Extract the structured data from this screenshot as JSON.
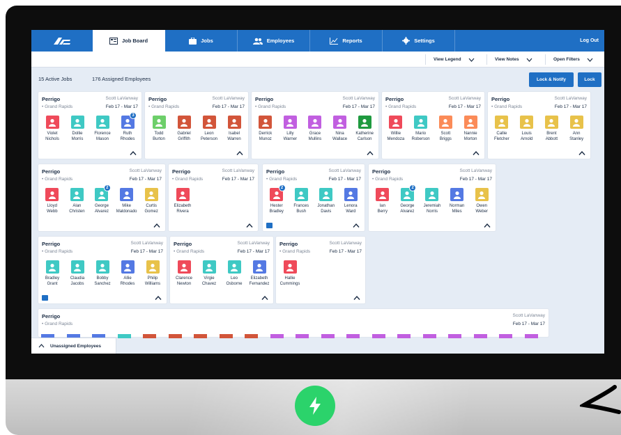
{
  "nav": {
    "tabs": [
      {
        "label": "Job Board",
        "icon": "board-icon",
        "active": true
      },
      {
        "label": "Jobs",
        "icon": "briefcase-icon"
      },
      {
        "label": "Employees",
        "icon": "people-icon"
      },
      {
        "label": "Reports",
        "icon": "chart-icon"
      },
      {
        "label": "Settings",
        "icon": "gear-icon"
      }
    ],
    "logout": "Log Out"
  },
  "subbar": {
    "legend": "View Legend",
    "notes": "View Notes",
    "filters": "Open Filters"
  },
  "summary": {
    "active_jobs": "15 Active Jobs",
    "assigned": "176 Assigned Employees"
  },
  "buttons": {
    "lock_notify": "Lock & Notify",
    "lock": "Lock"
  },
  "colors": {
    "red": "#ef4a5a",
    "teal": "#3fc9c4",
    "blue": "#5479e3",
    "green": "#6dcf6a",
    "rust": "#d2553a",
    "purple": "#c15fe0",
    "dkgreen": "#1f9a3f",
    "orange": "#fb8b58",
    "yellow": "#e8c24a",
    "accent": "#1f6fc4"
  },
  "jobs": [
    {
      "customer": "Perrigo",
      "location": "Grand Rapids",
      "manager": "Scott LaVanway",
      "dates": "Feb 17 - Mar 17",
      "employees": [
        [
          "Violet",
          "Nichols",
          "red"
        ],
        [
          "Dollie",
          "Morris",
          "teal"
        ],
        [
          "Florence",
          "Mason",
          "teal"
        ],
        [
          "Ruth",
          "Rhodes",
          "blue",
          "3"
        ]
      ]
    },
    {
      "customer": "Perrigo",
      "location": "Grand Rapids",
      "manager": "Scott LaVanway",
      "dates": "Feb 17 - Mar 17",
      "employees": [
        [
          "Todd",
          "Burton",
          "green"
        ],
        [
          "Gabriel",
          "Griffith",
          "rust"
        ],
        [
          "Leon",
          "Peterson",
          "rust"
        ],
        [
          "Isabel",
          "Warren",
          "rust"
        ]
      ]
    },
    {
      "customer": "Perrigo",
      "location": "Grand Rapids",
      "manager": "Scott LaVanway",
      "dates": "Feb 17 - Mar 17",
      "employees": [
        [
          "Derrick",
          "Munoz",
          "rust"
        ],
        [
          "Lilly",
          "Warner",
          "purple"
        ],
        [
          "Grace",
          "Mullins",
          "purple"
        ],
        [
          "Nina",
          "Wallace",
          "purple"
        ],
        [
          "Katherine",
          "Carlson",
          "dkgreen"
        ]
      ]
    },
    {
      "customer": "Perrigo",
      "location": "Grand Rapids",
      "manager": "Scott LaVanway",
      "dates": "Feb 17 - Mar 17",
      "employees": [
        [
          "Willie",
          "Mendoza",
          "red"
        ],
        [
          "Mario",
          "Roberson",
          "teal"
        ],
        [
          "Scott",
          "Briggs",
          "orange"
        ],
        [
          "Nannie",
          "Morton",
          "orange"
        ]
      ]
    },
    {
      "customer": "Perrigo",
      "location": "Grand Rapids",
      "manager": "Scott LaVanway",
      "dates": "Feb 17 - Mar 17",
      "employees": [
        [
          "Callie",
          "Fletcher",
          "yellow"
        ],
        [
          "Louis",
          "Arnold",
          "yellow"
        ],
        [
          "Brent",
          "Abbott",
          "yellow"
        ],
        [
          "Ann",
          "Stanley",
          "yellow"
        ]
      ]
    },
    {
      "customer": "Perrigo",
      "location": "Grand Rapids",
      "manager": "Scott LaVanway",
      "dates": "Feb 17 - Mar 17",
      "employees": [
        [
          "Lloyd",
          "Webb",
          "red"
        ],
        [
          "Alan",
          "Christen",
          "teal"
        ],
        [
          "George",
          "Alvarez",
          "teal",
          "2"
        ],
        [
          "Mike",
          "Maldonado",
          "blue"
        ],
        [
          "Curtis",
          "Gomez",
          "yellow"
        ]
      ]
    },
    {
      "customer": "Perrigo",
      "location": "Grand Rapids",
      "manager": "Scott LaVanway",
      "dates": "Feb 17 - Mar 17",
      "employees": [
        [
          "Elizabeth",
          "Rivera",
          "red"
        ]
      ]
    },
    {
      "customer": "Perrigo",
      "location": "Grand Rapids",
      "manager": "Scott LaVanway",
      "dates": "Feb 17 - Mar 17",
      "employees": [
        [
          "Hester",
          "Bradley",
          "red",
          "2"
        ],
        [
          "Frances",
          "Bush",
          "teal"
        ],
        [
          "Jonathan",
          "Davis",
          "teal"
        ],
        [
          "Lenora",
          "Ward",
          "blue"
        ]
      ]
    },
    {
      "customer": "Perrigo",
      "location": "Grand Rapids",
      "manager": "Scott LaVanway",
      "dates": "Feb 17 - Mar 17",
      "employees": [
        [
          "Ian",
          "Berry",
          "red"
        ],
        [
          "George",
          "Alvarez",
          "teal",
          "2"
        ],
        [
          "Jeremiah",
          "Norris",
          "teal"
        ],
        [
          "Norman",
          "Miles",
          "blue"
        ],
        [
          "Owen",
          "Weber",
          "yellow"
        ]
      ]
    },
    {
      "customer": "Perrigo",
      "location": "Grand Rapids",
      "manager": "Scott LaVanway",
      "dates": "Feb 17 - Mar 17",
      "employees": [
        [
          "Bradley",
          "Grant",
          "teal"
        ],
        [
          "Claudia",
          "Jacobs",
          "teal"
        ],
        [
          "Bobby",
          "Sanchez",
          "teal"
        ],
        [
          "Allie",
          "Rhodes",
          "blue"
        ],
        [
          "Philip",
          "Williams",
          "yellow"
        ]
      ]
    },
    {
      "customer": "Perrigo",
      "location": "Grand Rapids",
      "manager": "Scott LaVanway",
      "dates": "Feb 17 - Mar 17",
      "employees": [
        [
          "Clarence",
          "Newton",
          "red"
        ],
        [
          "Virgie",
          "Chavez",
          "teal"
        ],
        [
          "Leo",
          "Osborne",
          "teal"
        ],
        [
          "Elizabeth",
          "Fernandez",
          "blue"
        ]
      ]
    },
    {
      "customer": "Perrigo",
      "location": "Grand Rapids",
      "manager": "Scott LaVanway",
      "dates": "Feb 17 - Mar 17",
      "employees": [
        [
          "Hallie",
          "Cummings",
          "red"
        ]
      ]
    },
    {
      "customer": "Perrigo",
      "location": "Grand Rapids",
      "manager": "Scott LaVanway",
      "dates": "Feb 17 - Mar 17",
      "employees": []
    }
  ],
  "unassigned": "Unassigned Employees"
}
